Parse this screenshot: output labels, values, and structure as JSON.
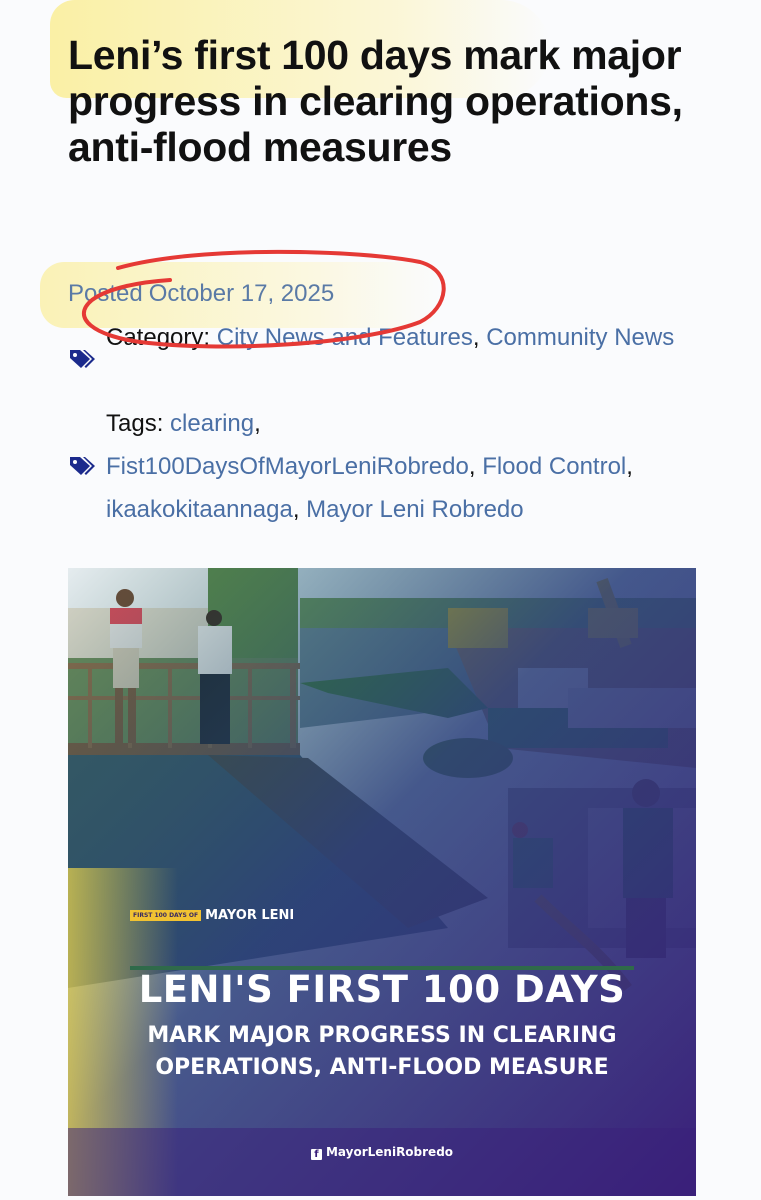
{
  "article": {
    "title": "Leni’s first 100 days mark major progress in clearing operations, anti-flood measures",
    "posted_label": "Posted",
    "posted_date": "October 17, 2025",
    "category_label": "Category:",
    "categories": [
      "City News and Features",
      "Community News"
    ],
    "tags_label": "Tags:",
    "tags": [
      "clearing",
      "Fist100DaysOfMayorLeniRobredo",
      "Flood Control",
      "ikaakokitaannaga",
      "Mayor Leni Robredo"
    ],
    "separator": ","
  },
  "hero_image": {
    "badge": "FIRST 100 DAYS OF",
    "brand": "MAYOR LENI",
    "headline": "LENI'S FIRST 100 DAYS",
    "subheadline_1": "MARK MAJOR PROGRESS IN CLEARING",
    "subheadline_2": "OPERATIONS, ANTI-FLOOD MEASURE",
    "facebook_handle": "MayorLeniRobredo"
  },
  "colors": {
    "link": "#4a6fa5",
    "date": "#5a7aa6",
    "annotation_circle": "#e53935",
    "highlight": "#f9ec9a",
    "tag_icon": "#1b2a8c"
  }
}
